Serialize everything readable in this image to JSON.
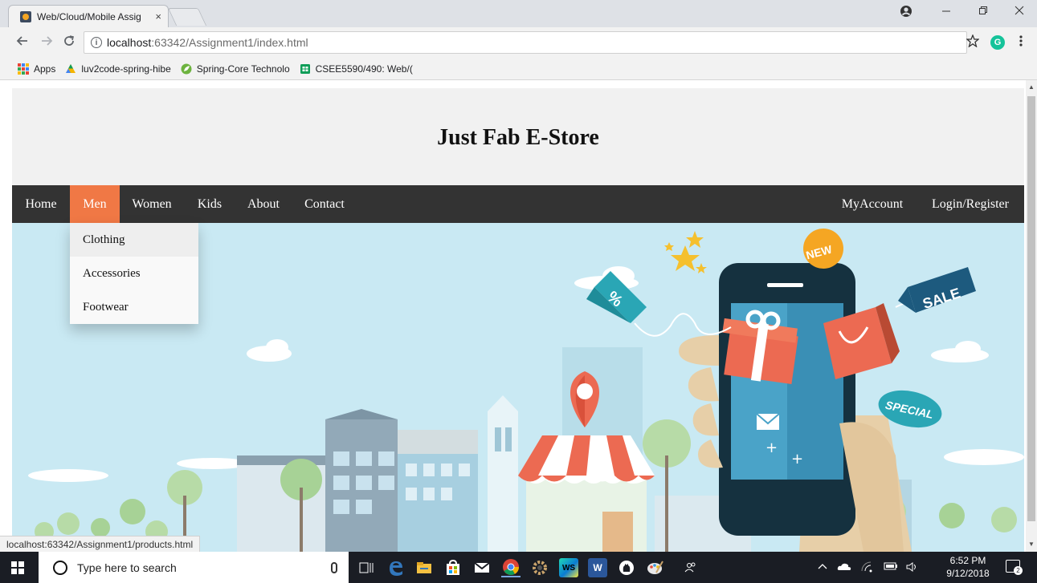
{
  "browser": {
    "tab_title": "Web/Cloud/Mobile Assig",
    "tab_close": "×",
    "url_host": "localhost",
    "url_path": ":63342/Assignment1/index.html",
    "bookmarks": [
      {
        "label": "Apps",
        "icon": "apps-grid-icon"
      },
      {
        "label": "luv2code-spring-hibe",
        "icon": "luv2code-icon"
      },
      {
        "label": "Spring-Core Technolo",
        "icon": "spring-leaf-icon"
      },
      {
        "label": "CSEE5590/490: Web/(",
        "icon": "sheets-icon"
      }
    ],
    "status_url": "localhost:63342/Assignment1/products.html",
    "grammarly_letter": "G"
  },
  "site": {
    "title": "Just Fab E-Store",
    "nav_left": [
      "Home",
      "Men",
      "Women",
      "Kids",
      "About",
      "Contact"
    ],
    "nav_right": [
      "MyAccount",
      "Login/Register"
    ],
    "active_nav": "Men",
    "active_color": "#f07845",
    "dropdown": [
      "Clothing",
      "Accessories",
      "Footwear"
    ],
    "hero_badges": {
      "new": "NEW",
      "sale": "SALE",
      "special": "SPECIAL",
      "percent": "%"
    }
  },
  "taskbar": {
    "search_placeholder": "Type here to search",
    "time": "6:52 PM",
    "date": "9/12/2018",
    "notification_count": "2",
    "word_letter": "W",
    "webstorm_letters": "WS"
  }
}
